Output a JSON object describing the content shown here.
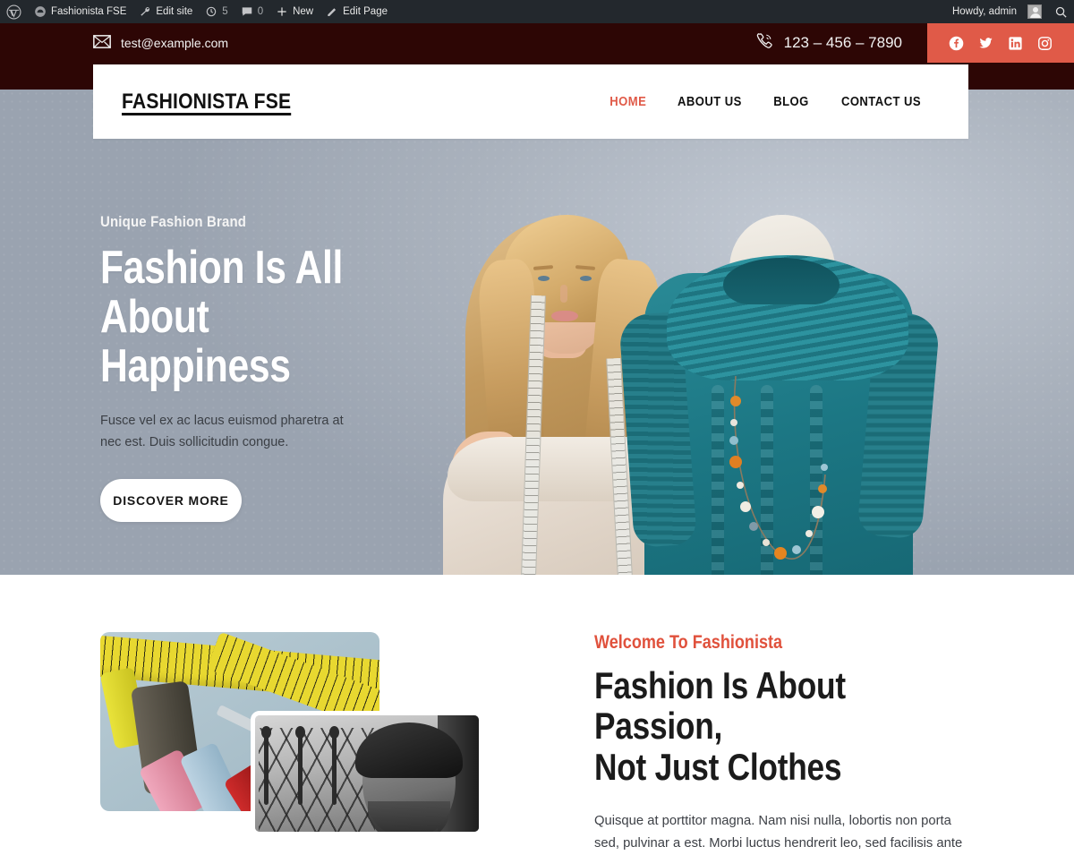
{
  "admin_bar": {
    "logo_icon": "wordpress-logo-icon",
    "items": [
      {
        "icon": "dashboard-icon",
        "label": "Fashionista FSE"
      },
      {
        "icon": "wrench-icon",
        "label": "Edit site"
      },
      {
        "icon": "revision-icon",
        "label": "5"
      },
      {
        "icon": "comment-icon",
        "label": "0"
      },
      {
        "icon": "plus-icon",
        "label": "New"
      },
      {
        "icon": "pencil-icon",
        "label": "Edit Page"
      }
    ],
    "howdy": "Howdy, admin",
    "search_icon": "search-icon"
  },
  "topbar": {
    "email_icon": "envelope-icon",
    "email": "test@example.com",
    "phone_icon": "phone-icon",
    "phone": "123 – 456 – 7890",
    "socials": [
      {
        "name": "facebook-icon",
        "label": "Facebook"
      },
      {
        "name": "twitter-icon",
        "label": "Twitter"
      },
      {
        "name": "linkedin-icon",
        "label": "LinkedIn"
      },
      {
        "name": "instagram-icon",
        "label": "Instagram"
      }
    ],
    "social_bg": "#e05a48",
    "bar_bg": "#2d0605"
  },
  "header": {
    "site_title": "FASHIONISTA FSE",
    "nav": [
      {
        "label": "HOME",
        "active": true
      },
      {
        "label": "ABOUT US",
        "active": false
      },
      {
        "label": "BLOG",
        "active": false
      },
      {
        "label": "CONTACT US",
        "active": false
      }
    ],
    "active_color": "#e05a48"
  },
  "hero": {
    "kicker": "Unique Fashion Brand",
    "title_line1": "Fashion Is All",
    "title_line2": "About Happiness",
    "description": "Fusce vel ex ac lacus euismod pharetra at nec est. Duis sollicitudin congue.",
    "button_label": "DISCOVER MORE",
    "background_color": "#aeb5c0"
  },
  "welcome": {
    "kicker": "Welcome To Fashionista",
    "title_line1": "Fashion Is About Passion,",
    "title_line2": "Not Just Clothes",
    "description": "Quisque at porttitor magna. Nam nisi nulla, lobortis non porta sed, pulvinar a est. Morbi luctus hendrerit leo, sed facilisis ante",
    "kicker_color": "#e0513c",
    "image_primary": "sewing-threads-photo",
    "image_secondary": "tailor-portrait-photo"
  }
}
